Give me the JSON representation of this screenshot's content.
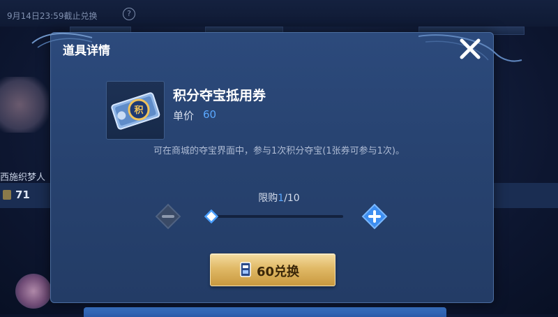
{
  "background": {
    "deadline_note": "9月14日23:59截止兑换",
    "help_icon": "?",
    "left_card_text": "西施织梦人",
    "left_card_count": "71"
  },
  "dialog": {
    "title": "道具详情",
    "close_icon": "close-icon"
  },
  "item": {
    "name": "积分夺宝抵用券",
    "price_label": "单价",
    "price_value": "60",
    "icon_text": "积",
    "description": "可在商城的夺宝界面中，参与1次积分夺宝(1张券可参与1次)。"
  },
  "purchase": {
    "limit_prefix": "限购",
    "limit_current": "1",
    "limit_suffix": "/10",
    "quantity_fraction": 0.1,
    "exchange_label": "60兑换",
    "exchange_icon": "coupon-icon"
  },
  "colors": {
    "accent_blue": "#5aa8ff",
    "gold_button": "#e0b966",
    "dialog_bg": "#27426f"
  }
}
